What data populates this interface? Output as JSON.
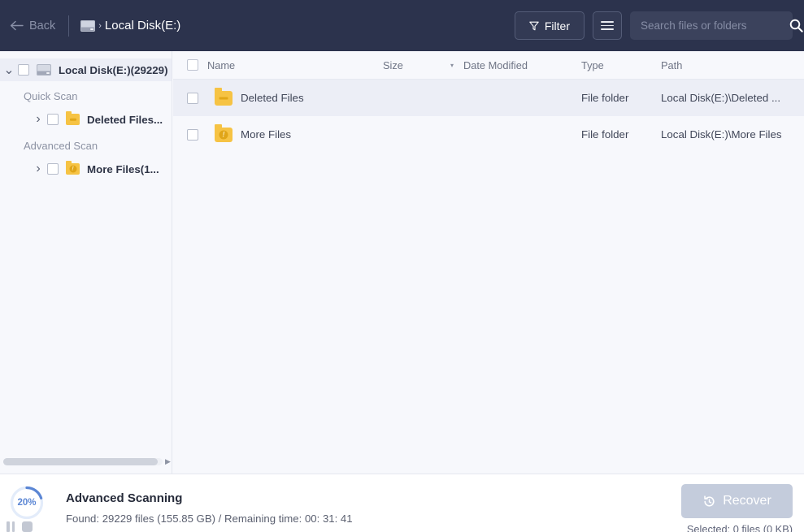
{
  "window": {
    "accent_dark": "#2c334d",
    "accent_blue": "#5b86d4",
    "folder_yellow": "#f6c344"
  },
  "topbar": {
    "back_label": "Back",
    "back_icon": "arrow-left-icon",
    "drive_icon": "hard-disk-icon",
    "breadcrumb_separator": "›",
    "breadcrumb_current": "Local Disk(E:)",
    "filter_label": "Filter",
    "filter_icon": "funnel-icon",
    "list_view_icon": "list-view-icon",
    "search": {
      "value": "",
      "placeholder": "Search files or folders",
      "icon": "search-icon"
    }
  },
  "sidebar": {
    "root": {
      "label": "Local Disk(E:)(29229)",
      "twisty": "⌄",
      "expanded": true,
      "checked": false,
      "icon": "hard-disk-icon",
      "selected": true
    },
    "groups": [
      {
        "label": "Quick Scan",
        "items": [
          {
            "label": "Deleted Files...",
            "twisty": "›",
            "expanded": false,
            "checked": false,
            "icon": "folder-deleted-icon",
            "badge": "–"
          }
        ]
      },
      {
        "label": "Advanced Scan",
        "items": [
          {
            "label": "More Files(1...",
            "twisty": "›",
            "expanded": false,
            "checked": false,
            "icon": "folder-more-icon",
            "badge": "!"
          }
        ]
      }
    ],
    "scrollbar": {
      "arrow": "▶"
    }
  },
  "filelist": {
    "select_all_checked": false,
    "sort_caret": "▾",
    "sorted_column": "Date Modified",
    "sort_direction": "descending",
    "columns": [
      {
        "key": "name",
        "label": "Name"
      },
      {
        "key": "size",
        "label": "Size"
      },
      {
        "key": "date",
        "label": "Date Modified"
      },
      {
        "key": "type",
        "label": "Type"
      },
      {
        "key": "path",
        "label": "Path"
      }
    ],
    "rows": [
      {
        "checked": false,
        "icon": "folder-deleted-icon",
        "badge": "–",
        "name": "Deleted Files",
        "size": "",
        "date": "",
        "type": "File folder",
        "path": "Local Disk(E:)\\Deleted ...",
        "selected": true
      },
      {
        "checked": false,
        "icon": "folder-more-icon",
        "badge": "!",
        "name": "More Files",
        "size": "",
        "date": "",
        "type": "File folder",
        "path": "Local Disk(E:)\\More Files",
        "selected": false
      }
    ]
  },
  "statusbar": {
    "progress_percent": 20,
    "progress_label": "20%",
    "title": "Advanced Scanning",
    "details": "Found: 29229 files (155.85 GB) / Remaining time: 00: 31: 41",
    "pause_icon": "pause-icon",
    "stop_icon": "stop-icon",
    "recover_label": "Recover",
    "recover_icon": "restore-clock-icon",
    "recover_enabled": false,
    "selected_summary": "Selected: 0 files (0 KB)"
  }
}
